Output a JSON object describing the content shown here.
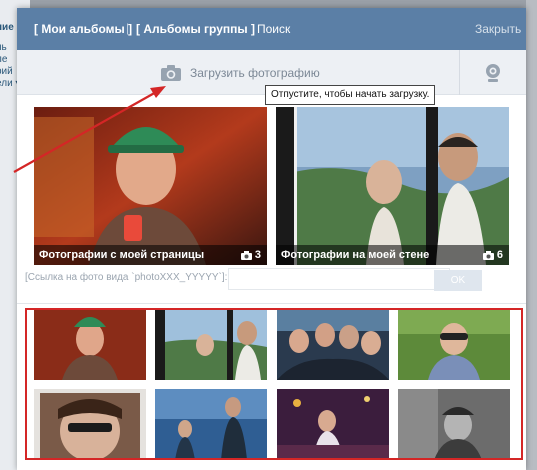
{
  "background_page": {
    "fragments": [
      "ние",
      "нь",
      "ле",
      "рий",
      "ели ▾"
    ]
  },
  "dialog": {
    "tabs": [
      {
        "label": "[ Мои альбомы ]"
      },
      {
        "label": "|"
      },
      {
        "label": "[ Альбомы группы ]"
      }
    ],
    "search_label": "Поиск",
    "close_label": "Закрыть",
    "upload": {
      "label": "Загрузить фотографию",
      "tooltip": "Отпустите, чтобы начать загрузку."
    },
    "albums": [
      {
        "title": "Фотографии с моей страницы",
        "count": "3"
      },
      {
        "title": "Фотографии на моей стене",
        "count": "6"
      }
    ],
    "link_input": {
      "label": "[Ссылка на фото вида `photoXXX_YYYYY`]:",
      "value": ""
    },
    "ok_label": "OK",
    "photos": [
      {
        "name": "photo-1"
      },
      {
        "name": "photo-2"
      },
      {
        "name": "photo-3"
      },
      {
        "name": "photo-4"
      },
      {
        "name": "photo-5"
      },
      {
        "name": "photo-6"
      },
      {
        "name": "photo-7"
      },
      {
        "name": "photo-8"
      }
    ]
  },
  "colors": {
    "header_bg": "#5b7fa6",
    "upload_bar_bg": "#edf0f4",
    "highlight_border": "#d42626",
    "arrow": "#d42626"
  },
  "icons": {
    "upload": "camera-icon",
    "webcam": "webcam-icon",
    "album_count": "camera-icon"
  }
}
